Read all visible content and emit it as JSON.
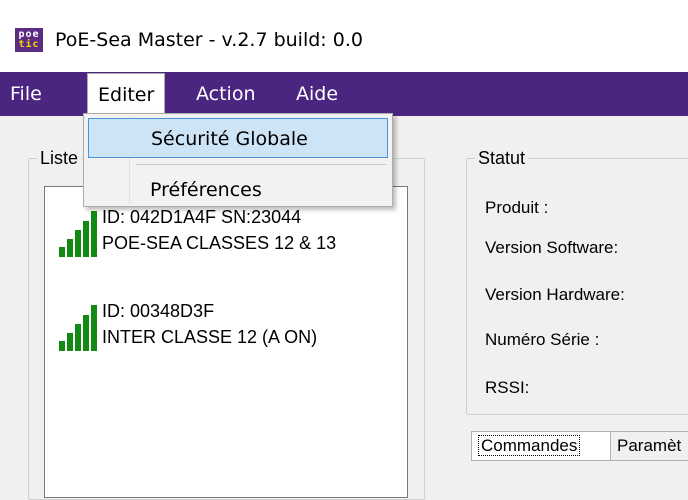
{
  "window": {
    "title": "PoE-Sea Master - v.2.7   build: 0.0",
    "icon_lines": [
      "poe",
      "tic"
    ]
  },
  "menubar": {
    "items": [
      "File",
      "Editer",
      "Action",
      "Aide"
    ],
    "open_menu": "Editer"
  },
  "edit_menu": {
    "items": [
      "Sécurité Globale",
      "Préférences"
    ],
    "highlighted": "Sécurité Globale"
  },
  "device_list": {
    "legend": "Liste",
    "devices": [
      {
        "id_line": "ID: 042D1A4F SN:23044",
        "name": "POE-SEA CLASSES 12 & 13",
        "signal_bars": 5
      },
      {
        "id_line": "ID: 00348D3F",
        "name": "INTER CLASSE 12 (A ON)",
        "signal_bars": 5
      }
    ]
  },
  "status": {
    "legend": "Statut",
    "fields": [
      "Produit :",
      "Version Software:",
      "Version Hardware:",
      "Numéro Série :",
      "RSSI:"
    ]
  },
  "tabs": [
    "Commandes",
    "Paramèt"
  ],
  "colors": {
    "menubar_bg": "#4b2680",
    "signal_green": "#138a13",
    "menu_highlight": "#cde4f7"
  }
}
